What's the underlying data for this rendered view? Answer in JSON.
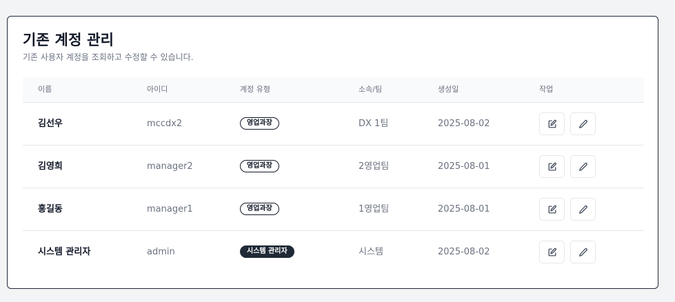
{
  "panel": {
    "title": "기존 계정 관리",
    "description": "기존 사용자 계정을 조회하고 수정할 수 있습니다."
  },
  "table": {
    "headers": {
      "name": "이름",
      "id": "아이디",
      "type": "계정 유형",
      "team": "소속/팀",
      "created": "생성일",
      "actions": "작업"
    },
    "rows": [
      {
        "name": "김선우",
        "id": "mccdx2",
        "type": "영업과장",
        "type_style": "outline",
        "team": "DX 1팀",
        "created": "2025-08-02"
      },
      {
        "name": "김영희",
        "id": "manager2",
        "type": "영업과장",
        "type_style": "outline",
        "team": "2영업팀",
        "created": "2025-08-01"
      },
      {
        "name": "홍길동",
        "id": "manager1",
        "type": "영업과장",
        "type_style": "outline",
        "team": "1영업팀",
        "created": "2025-08-01"
      },
      {
        "name": "시스템 관리자",
        "id": "admin",
        "type": "시스템 관리자",
        "type_style": "solid",
        "team": "시스템",
        "created": "2025-08-02"
      }
    ],
    "row_actions": [
      {
        "icon": "edit-square-icon"
      },
      {
        "icon": "pencil-icon"
      }
    ]
  },
  "colors": {
    "badge_dark": "#1f2937",
    "border": "#e5e7eb",
    "muted_text": "#6b7280"
  }
}
